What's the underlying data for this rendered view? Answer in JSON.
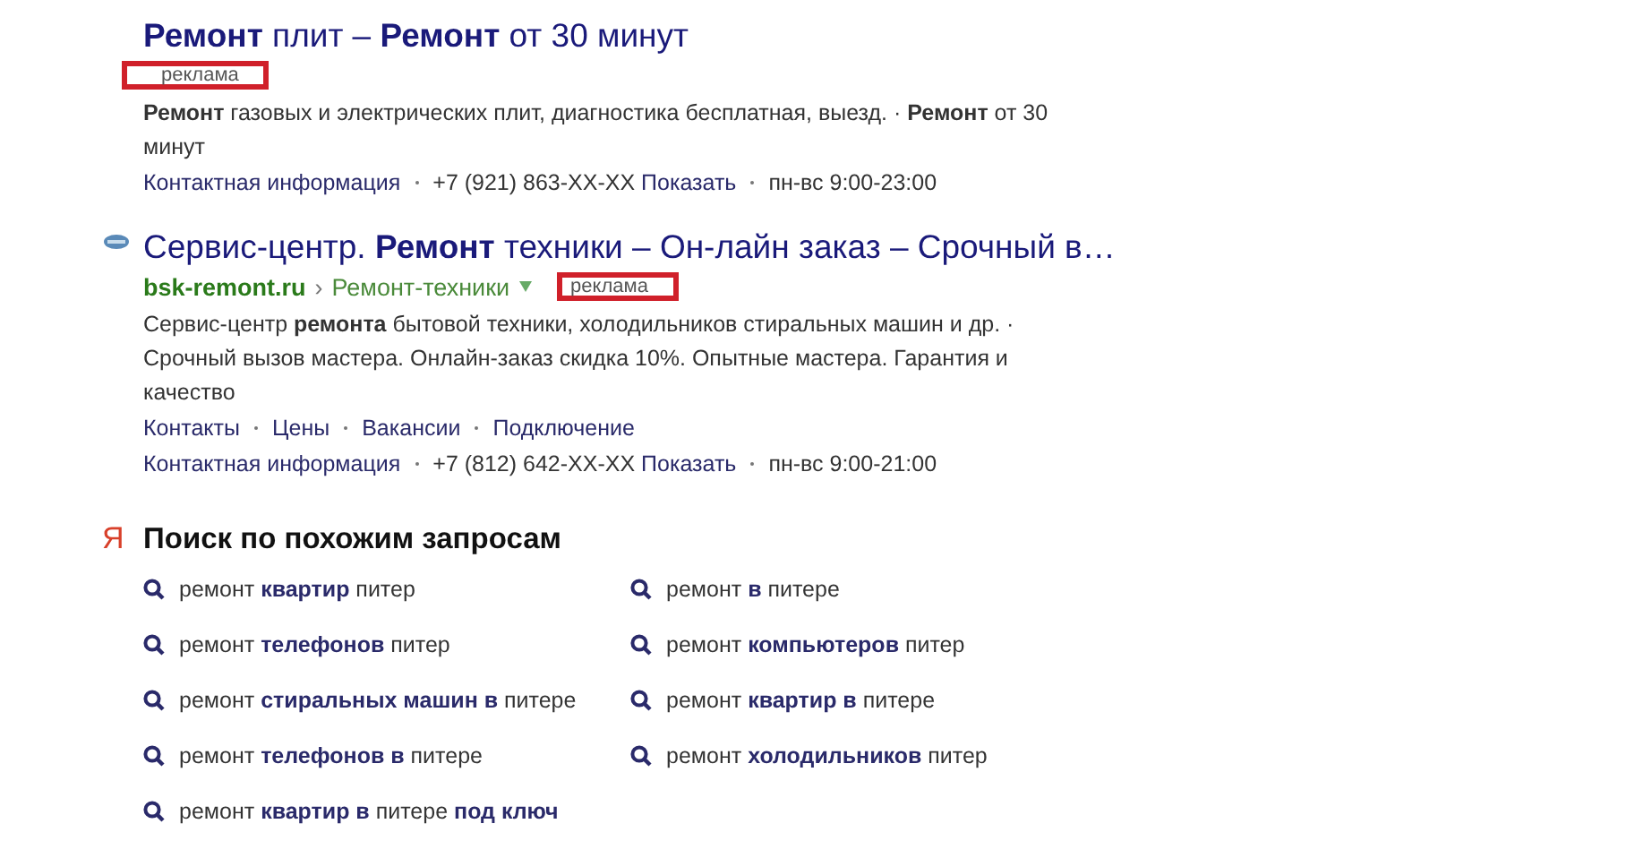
{
  "results": [
    {
      "title": "**Ремонт** плит – **Ремонт** от 30 минут",
      "favicon": false,
      "ad_label": {
        "text": "реклама",
        "highlighted": true
      },
      "snippet": "**Ремонт** газовых и электрических плит, диагностика бесплатная, выезд. · **Ремонт** от 30 минут",
      "contact": {
        "link": "Контактная информация",
        "phone": "+7 (921) 863-XX-XX",
        "show": "Показать",
        "hours": "пн-вс 9:00-23:00"
      }
    },
    {
      "title": "Сервис-центр. **Ремонт** техники – Он-лайн заказ – Срочный в…",
      "favicon": true,
      "url": {
        "domain": "bsk-remont.ru",
        "separator": "›",
        "path": "Ремонт-техники"
      },
      "ad_label": {
        "text": "реклама",
        "highlighted": true
      },
      "snippet": "Сервис-центр **ремонта** бытовой техники, холодильников стиральных машин и др. · Срочный вызов мастера. Онлайн-заказ скидка 10%. Опытные мастера. Гарантия и качество",
      "sitelinks": [
        "Контакты",
        "Цены",
        "Вакансии",
        "Подключение"
      ],
      "contact": {
        "link": "Контактная информация",
        "phone": "+7 (812) 642-XX-XX",
        "show": "Показать",
        "hours": "пн-вс 9:00-21:00"
      }
    }
  ],
  "related": {
    "logo": "Я",
    "title": "Поиск по похожим запросам",
    "items": [
      "ремонт **квартир** питер",
      "ремонт **в** питере",
      "ремонт **телефонов** питер",
      "ремонт **компьютеров** питер",
      "ремонт **стиральных машин в** питере",
      "ремонт **квартир в** питере",
      "ремонт **телефонов в** питере",
      "ремонт **холодильников** питер",
      "ремонт **квартир в** питере **под ключ**"
    ]
  }
}
